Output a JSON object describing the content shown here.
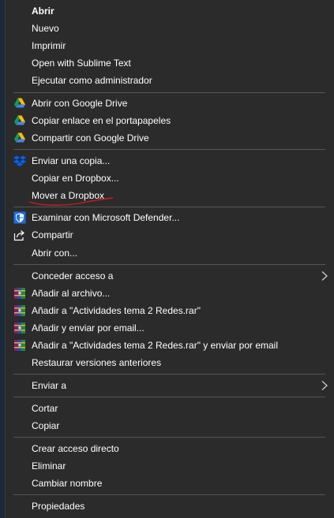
{
  "menu": {
    "open": "Abrir",
    "new": "Nuevo",
    "print": "Imprimir",
    "open_sublime": "Open with Sublime Text",
    "run_admin": "Ejecutar como administrador",
    "gdrive_open": "Abrir con Google Drive",
    "gdrive_copy_link": "Copiar enlace en el portapapeles",
    "gdrive_share": "Compartir con Google Drive",
    "dropbox_send_copy": "Enviar una copia...",
    "dropbox_copy": "Copiar en Dropbox...",
    "dropbox_move": "Mover a Dropbox",
    "defender_scan": "Examinar con Microsoft Defender...",
    "share": "Compartir",
    "open_with": "Abrir con...",
    "grant_access": "Conceder acceso a",
    "rar_add": "Añadir al archivo...",
    "rar_add_named": "Añadir a \"Actividades tema 2 Redes.rar\"",
    "rar_add_email": "Añadir y enviar por email...",
    "rar_add_named_email": "Añadir a \"Actividades tema 2 Redes.rar\" y enviar por email",
    "restore_versions": "Restaurar versiones anteriores",
    "send_to": "Enviar a",
    "cut": "Cortar",
    "copy": "Copiar",
    "create_shortcut": "Crear acceso directo",
    "delete": "Eliminar",
    "rename": "Cambiar nombre",
    "properties": "Propiedades"
  },
  "icons": {
    "gdrive": "google-drive-icon",
    "dropbox": "dropbox-icon",
    "defender": "microsoft-defender-icon",
    "share": "share-icon",
    "winrar": "winrar-icon",
    "submenu": "chevron-right-icon"
  },
  "colors": {
    "background": "#2b2b2b",
    "text": "#ffffff",
    "separator": "#555555",
    "annotation": "#d21c1c"
  }
}
